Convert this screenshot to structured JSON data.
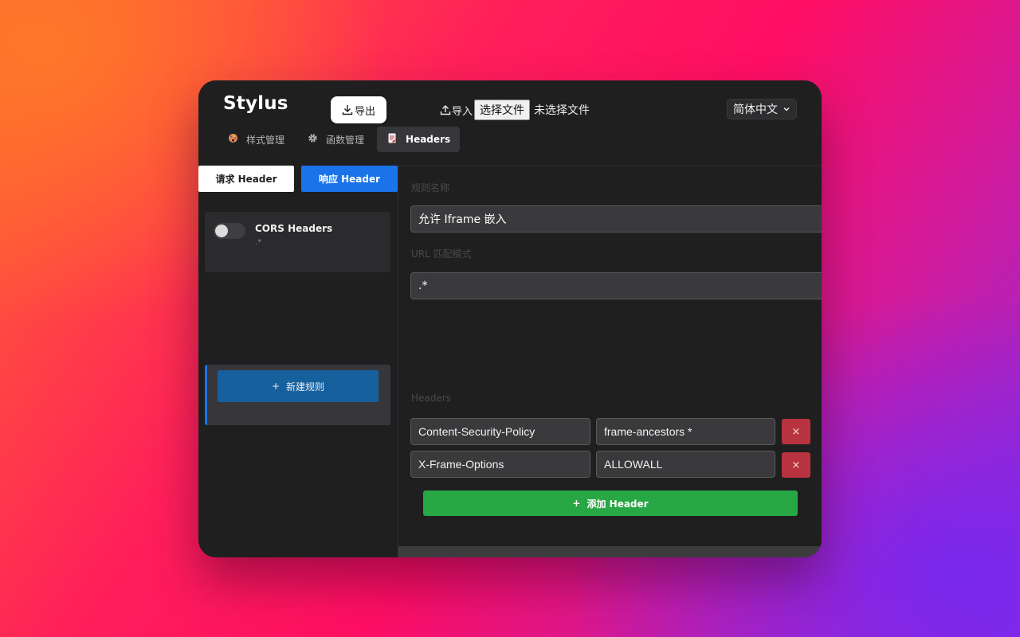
{
  "app": {
    "logo": "Stylus"
  },
  "toolbar": {
    "export_label": "导出",
    "import_label": "导入",
    "choose_file_label": "选择文件",
    "no_file_label": "未选择文件",
    "language": "简体中文"
  },
  "tabs": [
    {
      "label": "样式管理",
      "icon": "palette-icon",
      "active": false
    },
    {
      "label": "函数管理",
      "icon": "gear-icon",
      "active": false
    },
    {
      "label": "Headers",
      "icon": "document-icon",
      "active": true
    }
  ],
  "sidebar": {
    "segments": {
      "request": "请求 Header",
      "response": "响应 Header",
      "selected": "request"
    },
    "rules": [
      {
        "name": "CORS Headers",
        "pattern": ".*",
        "enabled": false,
        "active": false
      },
      {
        "name": "允许 Iframe 嵌入",
        "pattern": ".*",
        "enabled": true,
        "active": true
      }
    ],
    "new_rule_label": "新建规则"
  },
  "editor": {
    "rule_name_label": "规则名称",
    "rule_name_value": "允许 Iframe 嵌入",
    "url_pattern_label": "URL 匹配模式",
    "url_pattern_value": ".*",
    "headers_label": "Headers",
    "headers": [
      {
        "name": "Content-Security-Policy",
        "value": "frame-ancestors *"
      },
      {
        "name": "X-Frame-Options",
        "value": "ALLOWALL"
      }
    ],
    "delete_label": "×",
    "add_header_label": "添加 Header"
  },
  "colors": {
    "accent_blue": "#1a73e8",
    "danger_red": "#b8323f",
    "success_green": "#28a745",
    "panel_bg": "#1f1f20"
  }
}
